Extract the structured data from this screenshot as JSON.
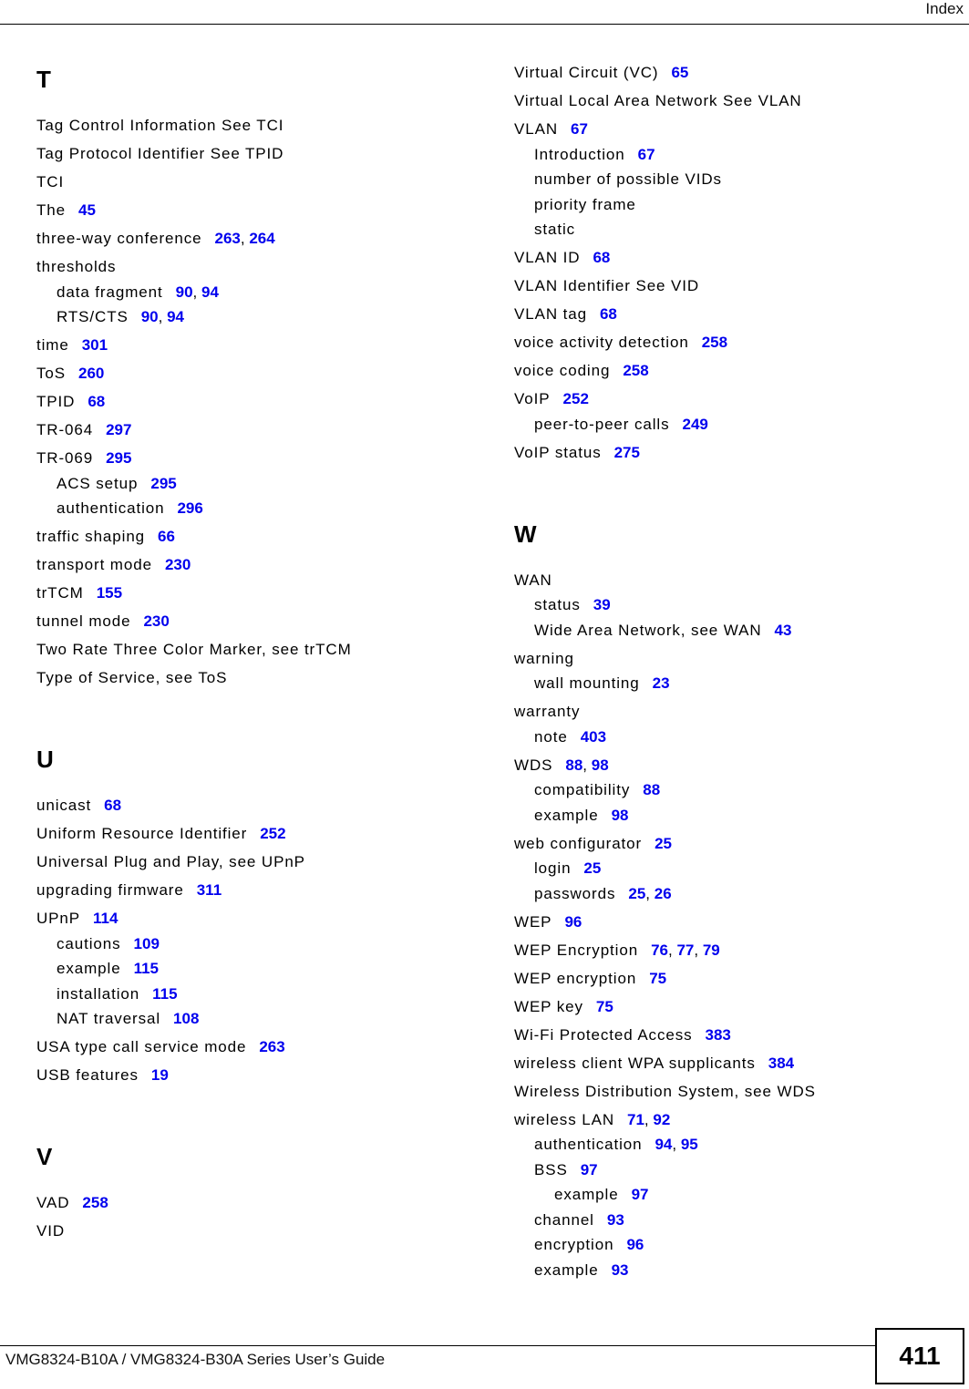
{
  "header": {
    "title": "Index"
  },
  "footer": {
    "guide_title": "VMG8324-B10A / VMG8324-B30A Series User’s Guide",
    "page_number": "411"
  },
  "colors": {
    "page_link": "#0000ee",
    "text": "#000000"
  },
  "columns": [
    {
      "sections": [
        {
          "letter": "T",
          "entries": [
            {
              "text": "Tag Control Information See TCI",
              "level": 0,
              "pages": []
            },
            {
              "text": "Tag Protocol Identifier See TPID",
              "level": 0,
              "pages": []
            },
            {
              "text": "TCI",
              "level": 0,
              "pages": []
            },
            {
              "text": "The",
              "level": 0,
              "pages": [
                "45"
              ]
            },
            {
              "text": "three-way conference",
              "level": 0,
              "pages": [
                "263",
                "264"
              ]
            },
            {
              "text": "thresholds",
              "level": 0,
              "pages": []
            },
            {
              "text": "data fragment",
              "level": 1,
              "pages": [
                "90",
                "94"
              ]
            },
            {
              "text": "RTS/CTS",
              "level": 1,
              "pages": [
                "90",
                "94"
              ]
            },
            {
              "text": "time",
              "level": 0,
              "pages": [
                "301"
              ]
            },
            {
              "text": "ToS",
              "level": 0,
              "pages": [
                "260"
              ]
            },
            {
              "text": "TPID",
              "level": 0,
              "pages": [
                "68"
              ]
            },
            {
              "text": "TR-064",
              "level": 0,
              "pages": [
                "297"
              ]
            },
            {
              "text": "TR-069",
              "level": 0,
              "pages": [
                "295"
              ]
            },
            {
              "text": "ACS setup",
              "level": 1,
              "pages": [
                "295"
              ]
            },
            {
              "text": "authentication",
              "level": 1,
              "pages": [
                "296"
              ]
            },
            {
              "text": "traffic shaping",
              "level": 0,
              "pages": [
                "66"
              ]
            },
            {
              "text": "transport mode",
              "level": 0,
              "pages": [
                "230"
              ]
            },
            {
              "text": "trTCM",
              "level": 0,
              "pages": [
                "155"
              ]
            },
            {
              "text": "tunnel mode",
              "level": 0,
              "pages": [
                "230"
              ]
            },
            {
              "text": "Two Rate Three Color Marker, see trTCM",
              "level": 0,
              "pages": []
            },
            {
              "text": "Type of Service, see ToS",
              "level": 0,
              "pages": []
            }
          ]
        },
        {
          "letter": "U",
          "entries": [
            {
              "text": "unicast",
              "level": 0,
              "pages": [
                "68"
              ]
            },
            {
              "text": "Uniform Resource Identifier",
              "level": 0,
              "pages": [
                "252"
              ]
            },
            {
              "text": "Universal Plug and Play, see UPnP",
              "level": 0,
              "pages": []
            },
            {
              "text": "upgrading firmware",
              "level": 0,
              "pages": [
                "311"
              ]
            },
            {
              "text": "UPnP",
              "level": 0,
              "pages": [
                "114"
              ]
            },
            {
              "text": "cautions",
              "level": 1,
              "pages": [
                "109"
              ]
            },
            {
              "text": "example",
              "level": 1,
              "pages": [
                "115"
              ]
            },
            {
              "text": "installation",
              "level": 1,
              "pages": [
                "115"
              ]
            },
            {
              "text": "NAT traversal",
              "level": 1,
              "pages": [
                "108"
              ]
            },
            {
              "text": "USA type call service mode",
              "level": 0,
              "pages": [
                "263"
              ]
            },
            {
              "text": "USB features",
              "level": 0,
              "pages": [
                "19"
              ]
            }
          ]
        },
        {
          "letter": "V",
          "entries": [
            {
              "text": "VAD",
              "level": 0,
              "pages": [
                "258"
              ]
            },
            {
              "text": "VID",
              "level": 0,
              "pages": []
            }
          ]
        }
      ]
    },
    {
      "sections": [
        {
          "letter": "",
          "entries": [
            {
              "text": "Virtual Circuit (VC)",
              "level": 0,
              "pages": [
                "65"
              ]
            },
            {
              "text": "Virtual Local Area Network See VLAN",
              "level": 0,
              "pages": []
            },
            {
              "text": "VLAN",
              "level": 0,
              "pages": [
                "67"
              ]
            },
            {
              "text": "Introduction",
              "level": 1,
              "pages": [
                "67"
              ]
            },
            {
              "text": "number of possible VIDs",
              "level": 1,
              "pages": []
            },
            {
              "text": "priority frame",
              "level": 1,
              "pages": []
            },
            {
              "text": "static",
              "level": 1,
              "pages": []
            },
            {
              "text": "VLAN ID",
              "level": 0,
              "pages": [
                "68"
              ]
            },
            {
              "text": "VLAN Identifier See VID",
              "level": 0,
              "pages": []
            },
            {
              "text": "VLAN tag",
              "level": 0,
              "pages": [
                "68"
              ]
            },
            {
              "text": "voice activity detection",
              "level": 0,
              "pages": [
                "258"
              ]
            },
            {
              "text": "voice coding",
              "level": 0,
              "pages": [
                "258"
              ]
            },
            {
              "text": "VoIP",
              "level": 0,
              "pages": [
                "252"
              ]
            },
            {
              "text": "peer-to-peer calls",
              "level": 1,
              "pages": [
                "249"
              ]
            },
            {
              "text": "VoIP status",
              "level": 0,
              "pages": [
                "275"
              ]
            }
          ]
        },
        {
          "letter": "W",
          "entries": [
            {
              "text": "WAN",
              "level": 0,
              "pages": []
            },
            {
              "text": "status",
              "level": 1,
              "pages": [
                "39"
              ]
            },
            {
              "text": "Wide Area Network, see WAN",
              "level": 1,
              "pages": [
                "43"
              ]
            },
            {
              "text": "warning",
              "level": 0,
              "pages": []
            },
            {
              "text": "wall mounting",
              "level": 1,
              "pages": [
                "23"
              ]
            },
            {
              "text": "warranty",
              "level": 0,
              "pages": []
            },
            {
              "text": "note",
              "level": 1,
              "pages": [
                "403"
              ]
            },
            {
              "text": "WDS",
              "level": 0,
              "pages": [
                "88",
                "98"
              ]
            },
            {
              "text": "compatibility",
              "level": 1,
              "pages": [
                "88"
              ]
            },
            {
              "text": "example",
              "level": 1,
              "pages": [
                "98"
              ]
            },
            {
              "text": "web configurator",
              "level": 0,
              "pages": [
                "25"
              ]
            },
            {
              "text": "login",
              "level": 1,
              "pages": [
                "25"
              ]
            },
            {
              "text": "passwords",
              "level": 1,
              "pages": [
                "25",
                "26"
              ]
            },
            {
              "text": "WEP",
              "level": 0,
              "pages": [
                "96"
              ]
            },
            {
              "text": "WEP Encryption",
              "level": 0,
              "pages": [
                "76",
                "77",
                "79"
              ]
            },
            {
              "text": "WEP encryption",
              "level": 0,
              "pages": [
                "75"
              ]
            },
            {
              "text": "WEP key",
              "level": 0,
              "pages": [
                "75"
              ]
            },
            {
              "text": "Wi-Fi Protected Access",
              "level": 0,
              "pages": [
                "383"
              ]
            },
            {
              "text": "wireless client WPA supplicants",
              "level": 0,
              "pages": [
                "384"
              ]
            },
            {
              "text": "Wireless Distribution System, see WDS",
              "level": 0,
              "pages": []
            },
            {
              "text": "wireless LAN",
              "level": 0,
              "pages": [
                "71",
                "92"
              ]
            },
            {
              "text": "authentication",
              "level": 1,
              "pages": [
                "94",
                "95"
              ]
            },
            {
              "text": "BSS",
              "level": 1,
              "pages": [
                "97"
              ]
            },
            {
              "text": "example",
              "level": 2,
              "pages": [
                "97"
              ]
            },
            {
              "text": "channel",
              "level": 1,
              "pages": [
                "93"
              ]
            },
            {
              "text": "encryption",
              "level": 1,
              "pages": [
                "96"
              ]
            },
            {
              "text": "example",
              "level": 1,
              "pages": [
                "93"
              ]
            }
          ]
        }
      ]
    }
  ]
}
